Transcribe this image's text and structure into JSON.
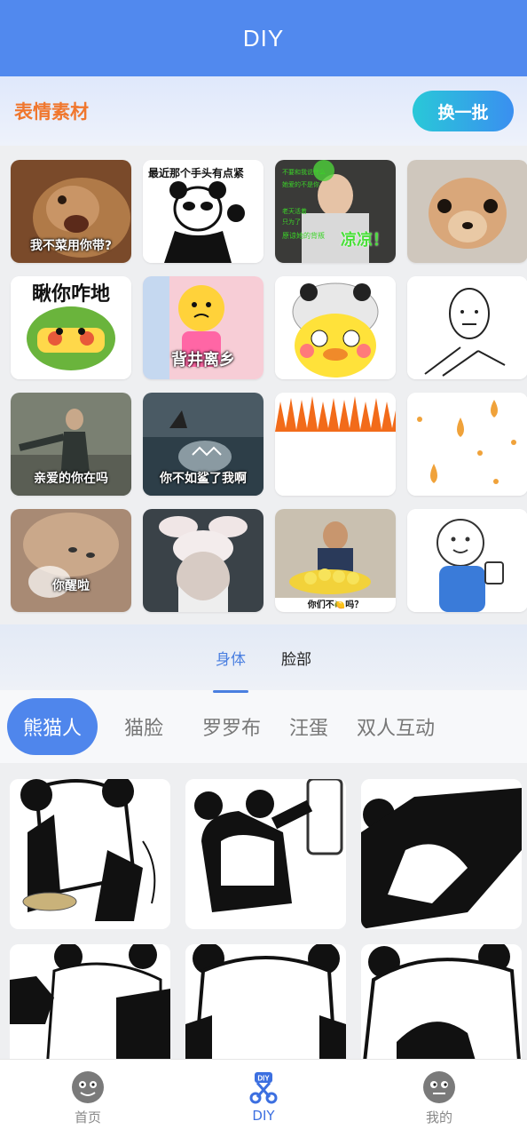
{
  "header": {
    "title": "DIY"
  },
  "materials": {
    "label": "表情素材",
    "refresh_label": "换一批",
    "stickers": [
      {
        "caption": "我不菜用你带?"
      },
      {
        "caption_top": "最近那个手头有点紧"
      },
      {
        "caption": "凉凉！"
      },
      {
        "caption": ""
      },
      {
        "caption_big": "瞅你咋地"
      },
      {
        "caption": "背井离乡"
      },
      {
        "caption": ""
      },
      {
        "caption": ""
      },
      {
        "caption": "亲爱的你在吗"
      },
      {
        "caption": "你不如鲨了我啊"
      },
      {
        "caption": ""
      },
      {
        "caption": ""
      },
      {
        "caption": "你醒啦"
      },
      {
        "caption": ""
      },
      {
        "caption": "你们不🍋吗？"
      },
      {
        "caption": ""
      }
    ]
  },
  "category_tabs": [
    {
      "label": "身体",
      "active": true
    },
    {
      "label": "脸部",
      "active": false
    }
  ],
  "sub_tabs": [
    {
      "label": "熊猫人",
      "active": true
    },
    {
      "label": "猫脸"
    },
    {
      "label": "罗罗布"
    },
    {
      "label": "汪蛋"
    },
    {
      "label": "双人互动"
    }
  ],
  "bottom_nav": [
    {
      "label": "首页",
      "icon": "face-icon"
    },
    {
      "label": "DIY",
      "icon": "scissors-icon",
      "active": true
    },
    {
      "label": "我的",
      "icon": "face-icon"
    }
  ],
  "colors": {
    "primary": "#5189ee",
    "accent": "#f0772e"
  }
}
